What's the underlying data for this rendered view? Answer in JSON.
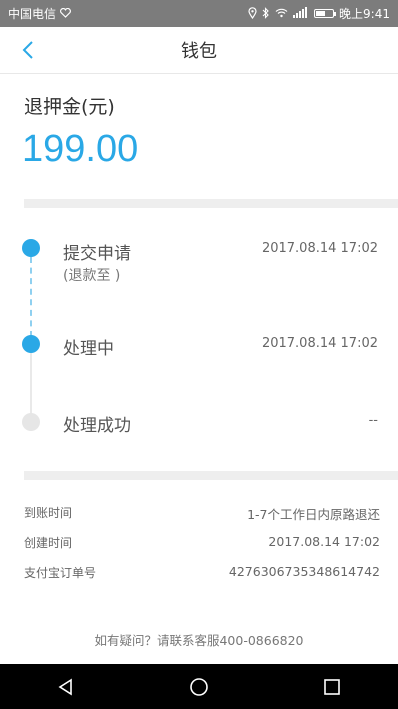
{
  "status_bar": {
    "carrier": "中国电信",
    "time": "晚上9:41",
    "battery_level": 0.55
  },
  "header": {
    "title": "钱包",
    "back_icon": "chevron-left-icon"
  },
  "deposit": {
    "label": "退押金(元)",
    "amount": "199.00"
  },
  "steps": [
    {
      "title": "提交申请",
      "subtitle": "(退款至 )",
      "time": "2017.08.14 17:02",
      "status": "done"
    },
    {
      "title": "处理中",
      "subtitle": "",
      "time": "2017.08.14 17:02",
      "status": "done"
    },
    {
      "title": "处理成功",
      "subtitle": "",
      "time": "--",
      "status": "pending"
    }
  ],
  "details": [
    {
      "label": "到账时间",
      "value": "1-7个工作日内原路退还"
    },
    {
      "label": "创建时间",
      "value": "2017.08.14 17:02"
    },
    {
      "label": "支付宝订单号",
      "value": "4276306735348614742"
    }
  ],
  "footer": {
    "help_text": "如有疑问？请联系客服400-0866820"
  },
  "colors": {
    "accent": "#2aa8e6",
    "status_bar": "#7c7c7c",
    "divider": "#eeeeee"
  }
}
